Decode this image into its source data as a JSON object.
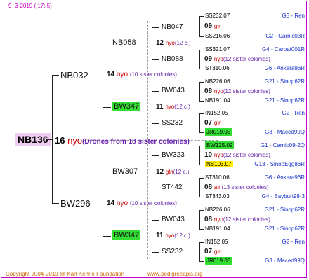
{
  "header": {
    "date": "9-  3-2019  ( 17:  5)"
  },
  "footer": {
    "copyright": "Copyright 2004-2019 @ Karl Kehrle Foundation",
    "website": "www.pedigreeapis.org"
  },
  "root": {
    "name": "NB136",
    "number": "16",
    "nyo": "nyo",
    "drones": "(Drones from 18 sister colonies)"
  },
  "gen1": [
    {
      "name": "NB032",
      "number": "14",
      "nyo": "nyo",
      "colonies": "(10 sister colonies)"
    },
    {
      "name": "BW296",
      "number": "14",
      "nyo": "nyo",
      "colonies": "(10 sister colonies)"
    }
  ],
  "gen2": [
    {
      "name": "NB058",
      "number": "12",
      "nyo": "nyo",
      "colonies": "(12 c.)"
    },
    {
      "name": "BW347",
      "number": "11",
      "nyo": "nyo",
      "colonies": "(12 c.)"
    },
    {
      "name": "BW307",
      "number": "12",
      "gln": "gln",
      "colonies": "(12 c.)"
    },
    {
      "name": "BW347",
      "number": "11",
      "nyo": "nyo",
      "colonies": "(12 c.)"
    }
  ],
  "gen3": [
    {
      "name": "NB047",
      "number": "09",
      "tag": "gln",
      "colonies": ""
    },
    {
      "name": "NB088",
      "number": "09",
      "tag": "nyo",
      "colonies": "(12 sister colonies)"
    },
    {
      "name": "BW043",
      "number": "08",
      "tag": "nyo",
      "colonies": "(12 sister colonies)"
    },
    {
      "name": "SS232",
      "number": "07",
      "tag": "gln",
      "colonies": ""
    },
    {
      "name": "BW323",
      "number": "10",
      "tag": "nyo",
      "colonies": "(12 sister colonies)"
    },
    {
      "name": "ST442",
      "number": "08",
      "tag": "alr.",
      "colonies": "(13 sister colonies)"
    },
    {
      "name": "BW043",
      "number": "08",
      "tag": "nyo",
      "colonies": "(12 sister colonies)"
    },
    {
      "name": "SS232",
      "number": "07",
      "tag": "gln",
      "colonies": ""
    }
  ],
  "gen4": [
    {
      "name": "SS232.07",
      "info": "G3 - Ren"
    },
    {
      "name": "SS216.06",
      "info": "G2 - Carnic03R"
    },
    {
      "name": "SS321.07",
      "info": "G4 - Carpat001R"
    },
    {
      "name": "ST310.06",
      "info": "G6 - Ankara96R"
    },
    {
      "name": "NB226.06",
      "info": "G21 - Sinop62R"
    },
    {
      "name": "NB191.04",
      "info": "G21 - Sinop62R"
    },
    {
      "name": "IN152.05",
      "info": "G2 - Ren"
    },
    {
      "name": "JR019.05",
      "info": "G3 - Maced99Q"
    },
    {
      "name": "BW125.09",
      "info": "G1 - Carnic09-2Q"
    },
    {
      "name": "NB103.07",
      "info": "G13 - SinopEgg86R"
    },
    {
      "name": "ST310.06",
      "info": "G6 - Ankara96R"
    },
    {
      "name": "ST343.03",
      "info": "G4 - Bayburt98-3"
    },
    {
      "name": "NB226.06",
      "info": "G21 - Sinop62R"
    },
    {
      "name": "NB191.04",
      "info": "G21 - Sinop62R"
    },
    {
      "name": "IN152.05",
      "info": "G2 - Ren"
    },
    {
      "name": "JR019.05",
      "info": "G3 - Maced99Q"
    }
  ]
}
